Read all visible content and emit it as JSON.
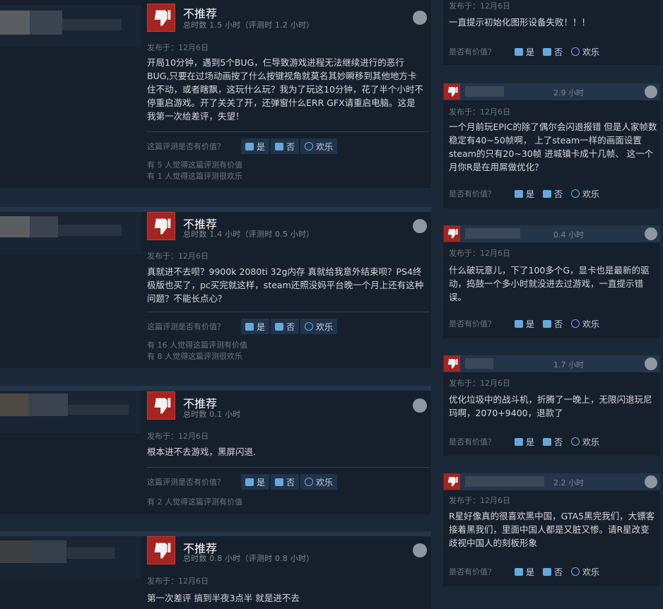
{
  "left_reviews": [
    {
      "verdict": "不推荐",
      "hours": "总时数 1.5 小时（评测时 1.2 小时）",
      "posted": "发布于：12月6日",
      "body": "开局10分钟，遇到5个BUG，仨导致游戏进程无法继续进行的恶行BUG,只要在过场动画按了什么按键视角就莫名其妙瞬移到其他地方卡住不动，或者瞎飘，这玩什么玩？我为了玩这10分钟，花了半个小时不停重启游戏。开了关关了开，还弹窗什么ERR GFX请重启电脑。这是我第一次给差评，失望！",
      "helpful_q": "这篇评测是否有价值？",
      "yes": "是",
      "no": "否",
      "funny": "欢乐",
      "counts": [
        "有 5 人觉得这篇评测有价值",
        "有 1 人觉得这篇评测很欢乐"
      ]
    },
    {
      "verdict": "不推荐",
      "hours": "总时数 1.4 小时（评测时 0.5 小时）",
      "posted": "发布于：12月6日",
      "body": "真就进不去呗？9900k 2080ti 32g内存 真就给我意外结束呗？PS4终极版也买了，pc买完就这样，steam还照没妈平台晚一个月上还有这种问题？不能长点心？",
      "helpful_q": "这篇评测是否有价值？",
      "yes": "是",
      "no": "否",
      "funny": "欢乐",
      "counts": [
        "有 16 人觉得这篇评测有价值",
        "有 8 人觉得这篇评测很欢乐"
      ]
    },
    {
      "verdict": "不推荐",
      "hours": "总时数 0.1 小时",
      "posted": "发布于：12月6日",
      "body": "根本进不去游戏，黑屏闪退.",
      "helpful_q": "这篇评测是否有价值？",
      "yes": "是",
      "no": "否",
      "funny": "欢乐",
      "counts": [
        "有 2 人觉得这篇评测有价值"
      ]
    },
    {
      "verdict": "不推荐",
      "hours": "总时数 0.8 小时（评测时 0.8 小时）",
      "posted": "发布于：12月6日",
      "body": "第一次差评 搞到半夜3点半 就是进不去"
    }
  ],
  "right_reviews": [
    {
      "posted": "发布于：12月6日",
      "body": "一直提示初始化图形设备失败！！！",
      "helpful_q": "是否有价值？",
      "yes": "是",
      "no": "否",
      "funny": "欢乐"
    },
    {
      "hours": "2.9 小时",
      "posted": "发布于：12月6日",
      "body": "一个月前玩EPIC的除了偶尔会闪退报错 但是人家帧数稳定有40~50帧啊， 上了steam一样的画面设置steam的只有20~30帧 进城镇卡成十几帧、 这一个月你R是在用屌做优化？",
      "helpful_q": "是否有价值？",
      "yes": "是",
      "no": "否",
      "funny": "欢乐"
    },
    {
      "hours": "0.4 小时",
      "posted": "发布于：12月6日",
      "body": "什么破玩意儿，下了100多个G，显卡也是最新的驱动，捣鼓一个多小时就没进去过游戏，一直提示错误。",
      "helpful_q": "是否有价值？",
      "yes": "是",
      "no": "否",
      "funny": "欢乐"
    },
    {
      "hours": "1.7 小时",
      "posted": "发布于：12月6日",
      "body": "优化垃圾中的战斗机，折腾了一晚上，无限闪退玩尼玛啊，2070+9400，退款了",
      "helpful_q": "是否有价值？",
      "yes": "是",
      "no": "否",
      "funny": "欢乐"
    },
    {
      "hours": "2.2 小时",
      "posted": "发布于：12月6日",
      "body": "R星好像真的很喜欢黑中国，GTA5黑完我们，大镖客接着黑我们，里面中国人都是又脏又惨。请R星改变歧视中国人的刻板形象",
      "helpful_q": "是否有价值？",
      "yes": "是",
      "no": "否",
      "funny": "欢乐"
    }
  ],
  "colors": {
    "thumb_red": "#a52420",
    "accent_blue": "#66a9dc",
    "bg": "#1b2838"
  },
  "icons": [
    "thumbs-down-icon",
    "steam-icon",
    "thumbs-up-icon",
    "smile-icon"
  ]
}
